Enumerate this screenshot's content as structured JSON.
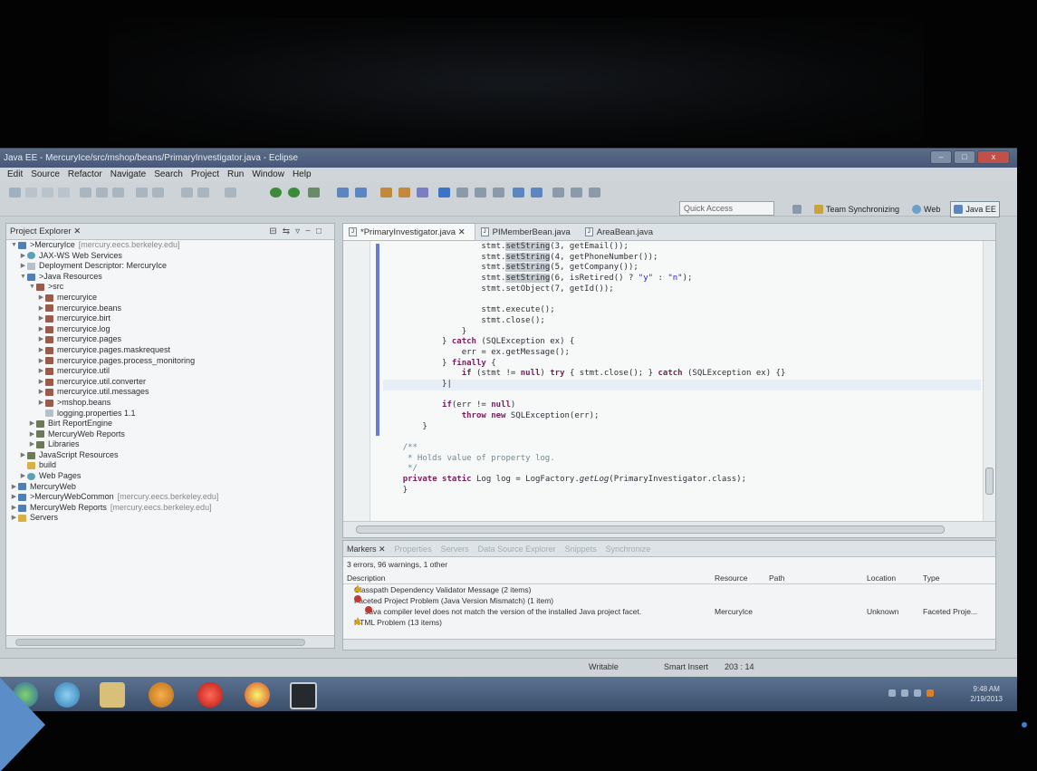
{
  "window": {
    "title": "Java EE - MercuryIce/src/mshop/beans/PrimaryInvestigator.java - Eclipse",
    "controls": [
      "–",
      "□",
      "x"
    ]
  },
  "menu": [
    "Edit",
    "Source",
    "Refactor",
    "Navigate",
    "Search",
    "Project",
    "Run",
    "Window",
    "Help"
  ],
  "toolbar": {
    "quick_access": "Quick Access",
    "perspectives": [
      "Team Synchronizing",
      "Web",
      "Java EE"
    ]
  },
  "explorer": {
    "title": "Project Explorer ✕",
    "tree": [
      {
        "label": ">MercuryIce",
        "extra": "[mercury.eecs.berkeley.edu]",
        "depth": 0,
        "icon": "project-icon",
        "twisty": "▼"
      },
      {
        "label": "JAX-WS Web Services",
        "extra": "",
        "depth": 1,
        "icon": "web-services-icon",
        "twisty": "▶"
      },
      {
        "label": "Deployment Descriptor: MercuryIce",
        "extra": "",
        "depth": 1,
        "icon": "descriptor-icon",
        "twisty": "▶"
      },
      {
        "label": ">Java Resources",
        "extra": "",
        "depth": 1,
        "icon": "java-resources-icon",
        "twisty": "▼"
      },
      {
        "label": ">src",
        "extra": "",
        "depth": 2,
        "icon": "source-folder-icon",
        "twisty": "▼"
      },
      {
        "label": "mercuryice",
        "extra": "",
        "depth": 3,
        "icon": "package-icon",
        "twisty": "▶"
      },
      {
        "label": "mercuryice.beans",
        "extra": "",
        "depth": 3,
        "icon": "package-icon",
        "twisty": "▶"
      },
      {
        "label": "mercuryice.birt",
        "extra": "",
        "depth": 3,
        "icon": "package-icon",
        "twisty": "▶"
      },
      {
        "label": "mercuryice.log",
        "extra": "",
        "depth": 3,
        "icon": "package-icon",
        "twisty": "▶"
      },
      {
        "label": "mercuryice.pages",
        "extra": "",
        "depth": 3,
        "icon": "package-icon",
        "twisty": "▶"
      },
      {
        "label": "mercuryice.pages.maskrequest",
        "extra": "",
        "depth": 3,
        "icon": "package-icon",
        "twisty": "▶"
      },
      {
        "label": "mercuryice.pages.process_monitoring",
        "extra": "",
        "depth": 3,
        "icon": "package-icon",
        "twisty": "▶"
      },
      {
        "label": "mercuryice.util",
        "extra": "",
        "depth": 3,
        "icon": "package-icon",
        "twisty": "▶"
      },
      {
        "label": "mercuryice.util.converter",
        "extra": "",
        "depth": 3,
        "icon": "package-icon",
        "twisty": "▶"
      },
      {
        "label": "mercuryice.util.messages",
        "extra": "",
        "depth": 3,
        "icon": "package-icon",
        "twisty": "▶"
      },
      {
        "label": ">mshop.beans",
        "extra": "",
        "depth": 3,
        "icon": "package-icon",
        "twisty": "▶"
      },
      {
        "label": "logging.properties 1.1",
        "extra": "",
        "depth": 3,
        "icon": "properties-file-icon",
        "twisty": ""
      },
      {
        "label": "Birt ReportEngine",
        "extra": "",
        "depth": 2,
        "icon": "library-icon",
        "twisty": "▶"
      },
      {
        "label": "MercuryWeb Reports",
        "extra": "",
        "depth": 2,
        "icon": "library-icon",
        "twisty": "▶"
      },
      {
        "label": "Libraries",
        "extra": "",
        "depth": 2,
        "icon": "library-icon",
        "twisty": "▶"
      },
      {
        "label": "JavaScript Resources",
        "extra": "",
        "depth": 1,
        "icon": "javascript-resources-icon",
        "twisty": "▶"
      },
      {
        "label": "build",
        "extra": "",
        "depth": 1,
        "icon": "folder-icon",
        "twisty": ""
      },
      {
        "label": "Web Pages",
        "extra": "",
        "depth": 1,
        "icon": "web-pages-icon",
        "twisty": "▶"
      },
      {
        "label": "MercuryWeb",
        "extra": "",
        "depth": 0,
        "icon": "project-icon",
        "twisty": "▶"
      },
      {
        "label": ">MercuryWebCommon",
        "extra": "[mercury.eecs.berkeley.edu]",
        "depth": 0,
        "icon": "project-icon",
        "twisty": "▶"
      },
      {
        "label": "MercuryWeb Reports",
        "extra": "[mercury.eecs.berkeley.edu]",
        "depth": 0,
        "icon": "project-icon",
        "twisty": "▶"
      },
      {
        "label": "Servers",
        "extra": "",
        "depth": 0,
        "icon": "servers-icon",
        "twisty": "▶"
      }
    ]
  },
  "editor": {
    "tabs": [
      "*PrimaryInvestigator.java ✕",
      "PIMemberBean.java",
      "AreaBean.java"
    ],
    "lines": [
      "                    stmt.setString(3, getEmail());",
      "                    stmt.setString(4, getPhoneNumber());",
      "                    stmt.setString(5, getCompany());",
      "                    stmt.setString(6, isRetired() ? \"y\" : \"n\");",
      "                    stmt.setObject(7, getId());",
      "",
      "                    stmt.execute();",
      "                    stmt.close();",
      "                }",
      "            } catch (SQLException ex) {",
      "                err = ex.getMessage();",
      "            } finally {",
      "                if (stmt != null) try { stmt.close(); } catch (SQLException ex) {}",
      "            }|",
      "",
      "            if(err != null)",
      "                throw new SQLException(err);",
      "        }",
      "",
      "    /**",
      "     * Holds value of property log.",
      "     */",
      "    private static Log log = LogFactory.getLog(PrimaryInvestigator.class);",
      "    }"
    ]
  },
  "markers": {
    "tabs": [
      "Markers ✕",
      "Properties",
      "Servers",
      "Data Source Explorer",
      "Snippets",
      "Synchronize"
    ],
    "summary": "3 errors, 96 warnings, 1 other",
    "columns": [
      "Description",
      "Resource",
      "Path",
      "Location",
      "Type"
    ],
    "rows": [
      {
        "description": "Classpath Dependency Validator Message (2 items)",
        "resource": "",
        "location": "",
        "type": "",
        "severity": "warning",
        "indent": 1
      },
      {
        "description": "Faceted Project Problem (Java Version Mismatch) (1 item)",
        "resource": "",
        "location": "",
        "type": "",
        "severity": "error",
        "indent": 1
      },
      {
        "description": "Java compiler level does not match the version of the installed Java project facet.",
        "resource": "MercuryIce",
        "location": "Unknown",
        "type": "Faceted Proje...",
        "severity": "error",
        "indent": 2
      },
      {
        "description": "HTML Problem (13 items)",
        "resource": "",
        "location": "",
        "type": "",
        "severity": "warning",
        "indent": 1
      }
    ]
  },
  "status": {
    "writable": "Writable",
    "insert_mode": "Smart Insert",
    "cursor": "203 : 14"
  },
  "taskbar": {
    "time": "9:48 AM",
    "date": "2/19/2013",
    "apps": [
      "start-button",
      "internet-explorer-icon",
      "file-explorer-icon",
      "media-player-icon",
      "opera-icon",
      "chrome-icon",
      "eclipse-icon"
    ]
  },
  "colors": {
    "ide_background": "#c9d0d3",
    "taskbar": "#3a4e6a",
    "slide_arrow": "#5b8ec9",
    "change_bar": "#6b7bd4",
    "error": "#c03a32",
    "warning": "#d9a21a"
  }
}
